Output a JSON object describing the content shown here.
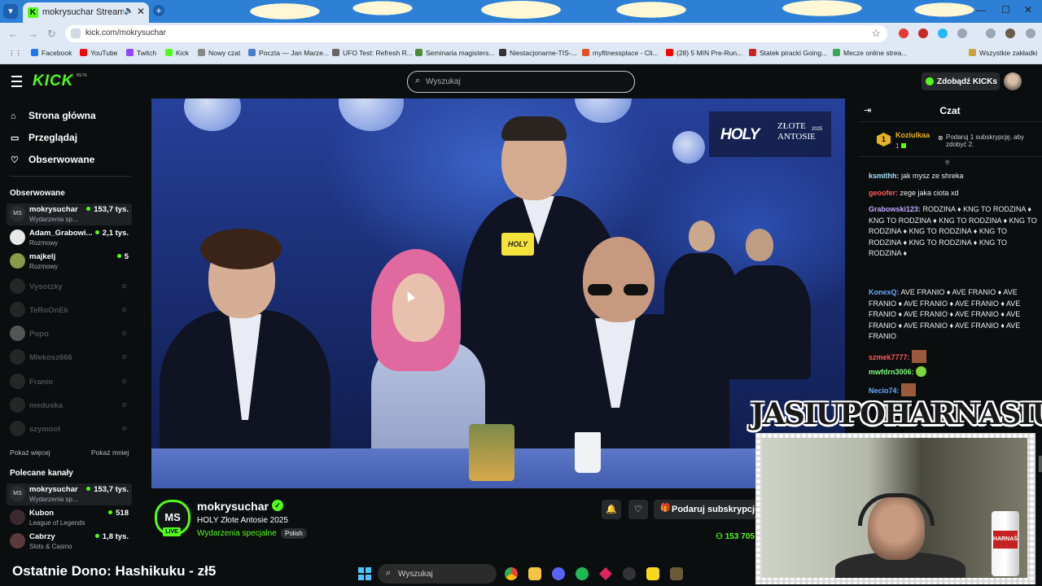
{
  "browser": {
    "tab_title": "mokrysuchar Stream - Watch",
    "url": "kick.com/mokrysuchar",
    "bookmarks": [
      {
        "label": "Facebook",
        "color": "#1877f2"
      },
      {
        "label": "YouTube",
        "color": "#ff0000"
      },
      {
        "label": "Twitch",
        "color": "#9146ff"
      },
      {
        "label": "Kick",
        "color": "#53fc18"
      },
      {
        "label": "Nowy czat",
        "color": "#888888"
      },
      {
        "label": "Poczta — Jan Marze...",
        "color": "#4a7bd0"
      },
      {
        "label": "UFO Test: Refresh R...",
        "color": "#666666"
      },
      {
        "label": "Seminaria magisters...",
        "color": "#4a8a3a"
      },
      {
        "label": "Niestacjonarne-TIS-...",
        "color": "#333333"
      },
      {
        "label": "myfitnessplace - Cli...",
        "color": "#e05020"
      },
      {
        "label": "(28) 5 MIN Pre-Run...",
        "color": "#ff0000"
      },
      {
        "label": "Statek piracki Going...",
        "color": "#cc2222"
      },
      {
        "label": "Mecze online strea...",
        "color": "#3aa655"
      }
    ],
    "all_bookmarks_label": "Wszystkie zakładki"
  },
  "kick": {
    "logo": "KICK",
    "beta": "BETA",
    "search_placeholder": "Wyszukaj",
    "get_kicks": "Zdobądź KICKs"
  },
  "sidebar": {
    "nav": [
      {
        "label": "Strona główna",
        "icon": "home-icon"
      },
      {
        "label": "Przeglądaj",
        "icon": "browse-icon"
      },
      {
        "label": "Obserwowane",
        "icon": "heart-icon"
      }
    ],
    "followed_heading": "Obserwowane",
    "followed": [
      {
        "name": "mokrysuchar",
        "category": "Wydarzenia sp...",
        "viewers": "153,7 tys.",
        "live": true
      },
      {
        "name": "Adam_Grabowi...",
        "category": "Rozmowy",
        "viewers": "2,1 tys.",
        "live": true
      },
      {
        "name": "majkelj",
        "category": "Rozmowy",
        "viewers": "5",
        "live": true
      },
      {
        "name": "Vysotzky",
        "live": false
      },
      {
        "name": "TeRoOnEk",
        "live": false
      },
      {
        "name": "Popo",
        "live": false
      },
      {
        "name": "Mlekosz666",
        "live": false
      },
      {
        "name": "Franio",
        "live": false
      },
      {
        "name": "meduska",
        "live": false
      },
      {
        "name": "szymool",
        "live": false
      }
    ],
    "show_more": "Pokaż więcej",
    "show_less": "Pokaż mniej",
    "recommended_heading": "Polecane kanały",
    "recommended": [
      {
        "name": "mokrysuchar",
        "category": "Wydarzenia sp...",
        "viewers": "153,7 tys."
      },
      {
        "name": "Kubon",
        "category": "League of Legends",
        "viewers": "518"
      },
      {
        "name": "Cabrzy",
        "category": "Slots & Casino",
        "viewers": "1,8 tys."
      }
    ]
  },
  "video": {
    "badge_brand": "HOLY",
    "badge_title_1": "ZŁOTE",
    "badge_title_2": "ANTOSIE",
    "badge_year": "2025"
  },
  "stream": {
    "initials": "MS",
    "live": "LIVE",
    "username": "mokrysuchar",
    "title": "HOLY Złote Antosie 2025",
    "category": "Wydarzenia specjalne",
    "language": "Polish",
    "subscribe_label": "Podaruj subskrypcje",
    "viewers": "153 705"
  },
  "chat": {
    "title": "Czat",
    "pinned": {
      "rank": "1",
      "user": "Koziulkaa",
      "count": "1",
      "gift_text": "Podaruj 1 subskrypcję, aby zdobyć 2."
    },
    "messages": [
      {
        "user": "ksmithh:",
        "color": "#a8e4ff",
        "text": "jak mysz ze shreka"
      },
      {
        "user": "geoofer:",
        "color": "#ff5c5c",
        "text": "zege jaka ciota xd"
      },
      {
        "user": "Grabowski123:",
        "color": "#c4a8ff",
        "text": "RODZINA ♦ KNG TO RODZINA ♦ KNG TO RODZINA ♦ KNG TO RODZINA ♦ KNG TO RODZINA ♦ KNG TO RODZINA ♦ KNG TO RODZINA ♦ KNG TO RODZINA ♦ KNG TO RODZINA ♦"
      },
      {
        "user": "KonexQ:",
        "color": "#6aa8ff",
        "text": "AVE FRANIO ♦ AVE FRANIO ♦ AVE FRANIO ♦ AVE FRANIO ♦ AVE FRANIO ♦ AVE FRANIO ♦ AVE FRANIO ♦ AVE FRANIO ♦ AVE FRANIO ♦ AVE FRANIO ♦ AVE FRANIO ♦ AVE FRANIO"
      },
      {
        "user": "szmek7777:",
        "color": "#ff5c5c",
        "text": ""
      },
      {
        "user": "mwfdrn3006:",
        "color": "#7fff7f",
        "text": ""
      },
      {
        "user": "Necio74:",
        "color": "#6aa8ff",
        "text": ""
      }
    ]
  },
  "overlay": {
    "cam_title": "JASIUPOHARNASIU",
    "can_label": "HARNAŚ",
    "last_donation": "Ostatnie Dono: Hashikuku - zł5"
  },
  "taskbar": {
    "search_placeholder": "Wyszukaj"
  },
  "colors": {
    "kick_green": "#53fc18",
    "background": "#0b0e0f",
    "browser_blue": "#2e7fd6"
  }
}
